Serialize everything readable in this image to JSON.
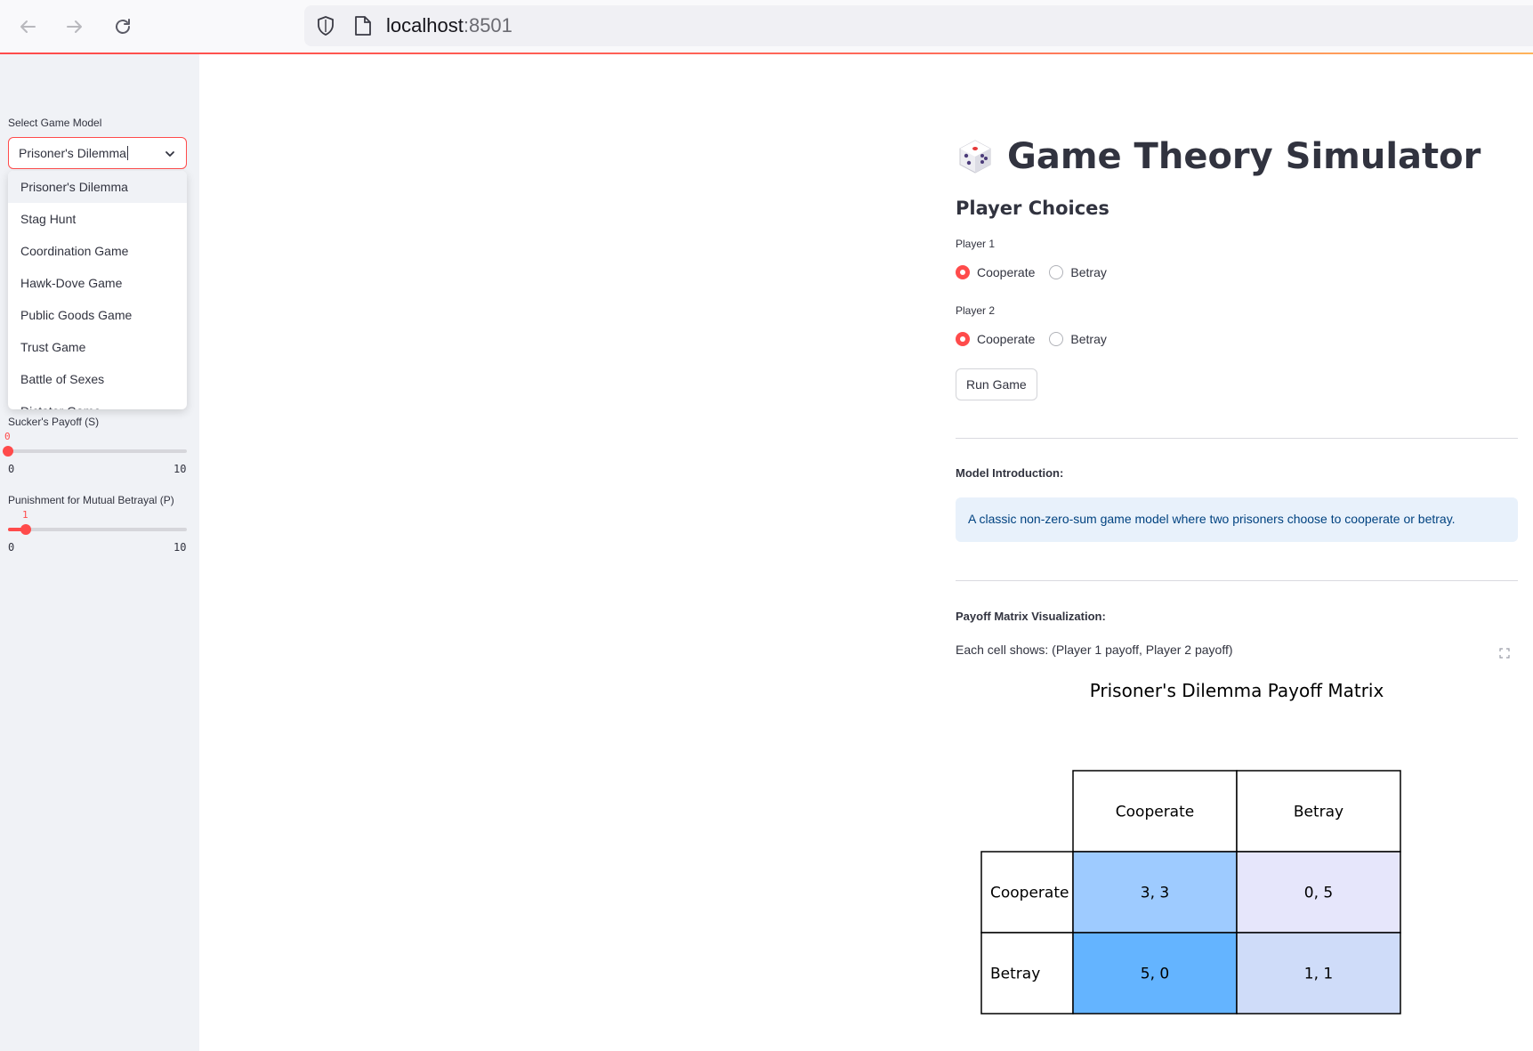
{
  "browser": {
    "url_host": "localhost",
    "url_port": ":8501",
    "icons": [
      "back-arrow-icon",
      "forward-arrow-icon",
      "reload-icon",
      "shield-icon",
      "page-icon"
    ]
  },
  "sidebar": {
    "select_label": "Select Game Model",
    "select_value": "Prisoner's Dilemma",
    "options": [
      "Prisoner's Dilemma",
      "Stag Hunt",
      "Coordination Game",
      "Hawk-Dove Game",
      "Public Goods Game",
      "Trust Game",
      "Battle of Sexes",
      "Dictator Game"
    ],
    "sliders": [
      {
        "label": "Sucker's Payoff (S)",
        "value": 0,
        "min": 0,
        "max": 10,
        "value_text": "0",
        "min_text": "0",
        "max_text": "10"
      },
      {
        "label": "Punishment for Mutual Betrayal (P)",
        "value": 1,
        "min": 0,
        "max": 10,
        "value_text": "1",
        "min_text": "0",
        "max_text": "10"
      }
    ]
  },
  "main": {
    "title": "Game Theory Simulator",
    "title_icon": "dice-icon",
    "subheader": "Player Choices",
    "player1": {
      "label": "Player 1",
      "options": [
        "Cooperate",
        "Betray"
      ],
      "selected": "Cooperate"
    },
    "player2": {
      "label": "Player 2",
      "options": [
        "Cooperate",
        "Betray"
      ],
      "selected": "Cooperate"
    },
    "run_button": "Run Game",
    "intro_label": "Model Introduction:",
    "intro_text": "A classic non-zero-sum game model where two prisoners choose to cooperate or betray.",
    "payoff_label": "Payoff Matrix Visualization:",
    "payoff_caption": "Each cell shows: (Player 1 payoff, Player 2 payoff)"
  },
  "chart_data": {
    "type": "table",
    "title": "Prisoner's Dilemma Payoff Matrix",
    "columns": [
      "Cooperate",
      "Betray"
    ],
    "rows": [
      "Cooperate",
      "Betray"
    ],
    "cells": [
      [
        "3, 3",
        "0, 5"
      ],
      [
        "5, 0",
        "1, 1"
      ]
    ],
    "cell_colors": [
      [
        "#9ecbff",
        "#e6e6fb"
      ],
      [
        "#64b4ff",
        "#cfdcf9"
      ]
    ]
  },
  "colors": {
    "accent": "#ff4b4b",
    "info_bg": "#e8f1fb",
    "info_text": "#004280",
    "sidebar_bg": "#f0f2f6"
  }
}
